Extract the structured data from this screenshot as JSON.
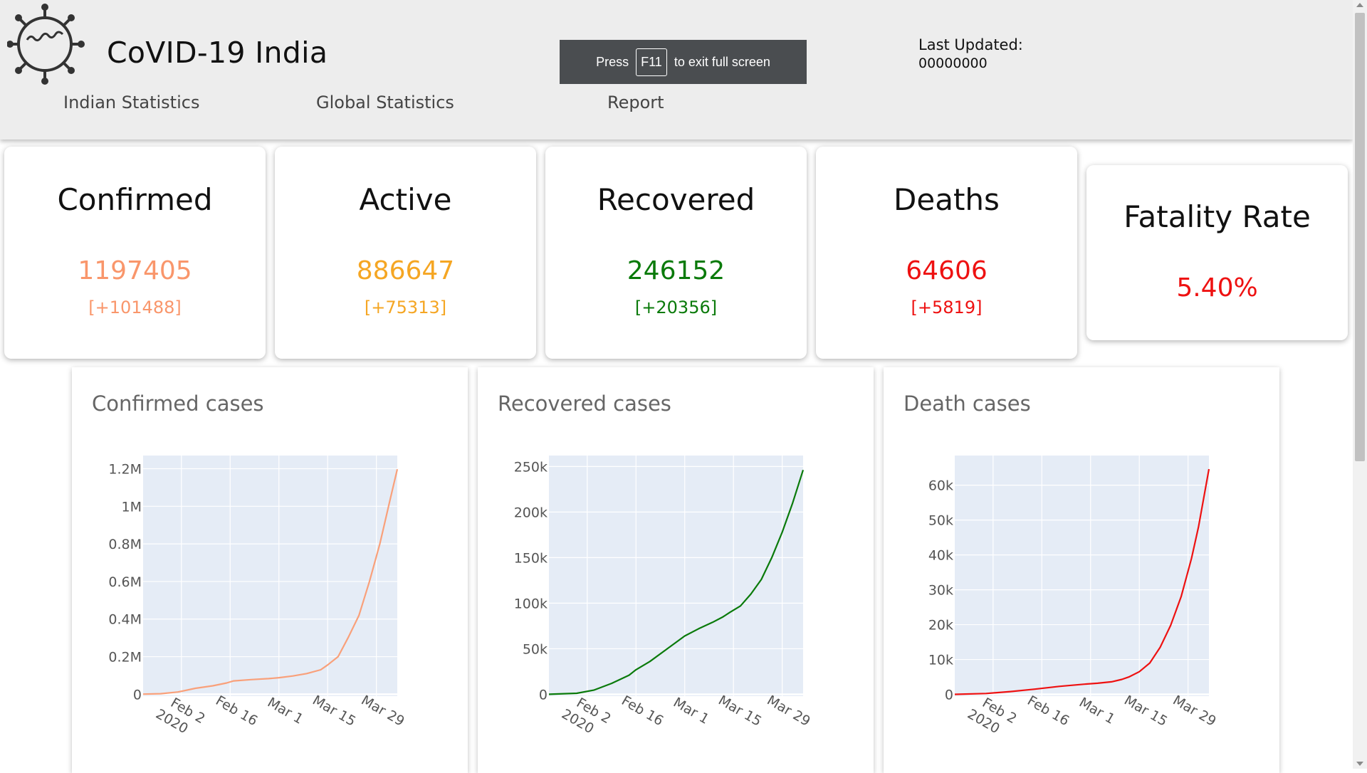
{
  "header": {
    "title": "CoVID-19 India",
    "nav": [
      "Indian Statistics",
      "Global Statistics",
      "Report"
    ],
    "last_updated_label": "Last Updated:",
    "last_updated_value": "00000000"
  },
  "fullscreen_banner": {
    "press": "Press",
    "key": "F11",
    "suffix": "to exit full screen"
  },
  "stats": [
    {
      "title": "Confirmed",
      "value": "1197405",
      "delta": "[+101488]",
      "color": "#f9966b"
    },
    {
      "title": "Active",
      "value": "886647",
      "delta": "[+75313]",
      "color": "#f5a623"
    },
    {
      "title": "Recovered",
      "value": "246152",
      "delta": "[+20356]",
      "color": "#0a7a0a"
    },
    {
      "title": "Deaths",
      "value": "64606",
      "delta": "[+5819]",
      "color": "#ee1111"
    },
    {
      "title": "Fatality Rate",
      "value": "5.40%",
      "color": "#ee1111"
    }
  ],
  "chart_data": [
    {
      "type": "line",
      "title": "Confirmed cases",
      "color": "#f9a07a",
      "x_ticks": [
        "Feb 2\n2020",
        "Feb 16",
        "Mar 1",
        "Mar 15",
        "Mar 29"
      ],
      "x_range": [
        "2020-01-22",
        "2020-04-04"
      ],
      "y_ticks": [
        0,
        200000,
        400000,
        600000,
        800000,
        1000000,
        1200000
      ],
      "y_tick_labels": [
        "0",
        "0.2M",
        "0.4M",
        "0.6M",
        "0.8M",
        "1M",
        "1.2M"
      ],
      "ylim": [
        -10000,
        1270000
      ],
      "x": [
        "2020-01-22",
        "2020-01-27",
        "2020-02-01",
        "2020-02-06",
        "2020-02-11",
        "2020-02-15",
        "2020-02-17",
        "2020-02-22",
        "2020-02-27",
        "2020-03-01",
        "2020-03-05",
        "2020-03-09",
        "2020-03-13",
        "2020-03-15",
        "2020-03-18",
        "2020-03-21",
        "2020-03-24",
        "2020-03-27",
        "2020-03-30",
        "2020-04-02",
        "2020-04-04"
      ],
      "y": [
        555,
        2900,
        12000,
        31500,
        45000,
        60000,
        71000,
        78000,
        83000,
        88000,
        97000,
        110000,
        130000,
        156000,
        200000,
        305000,
        420000,
        600000,
        800000,
        1040000,
        1197405
      ]
    },
    {
      "type": "line",
      "title": "Recovered cases",
      "color": "#0a7a0a",
      "x_ticks": [
        "Feb 2\n2020",
        "Feb 16",
        "Mar 1",
        "Mar 15",
        "Mar 29"
      ],
      "x_range": [
        "2020-01-22",
        "2020-04-04"
      ],
      "y_ticks": [
        0,
        50000,
        100000,
        150000,
        200000,
        250000
      ],
      "y_tick_labels": [
        "0",
        "50k",
        "100k",
        "150k",
        "200k",
        "250k"
      ],
      "ylim": [
        -2000,
        262000
      ],
      "x": [
        "2020-01-22",
        "2020-01-30",
        "2020-02-04",
        "2020-02-09",
        "2020-02-14",
        "2020-02-16",
        "2020-02-20",
        "2020-02-25",
        "2020-03-01",
        "2020-03-05",
        "2020-03-09",
        "2020-03-12",
        "2020-03-14",
        "2020-03-17",
        "2020-03-20",
        "2020-03-23",
        "2020-03-26",
        "2020-03-29",
        "2020-04-01",
        "2020-04-04"
      ],
      "y": [
        28,
        1100,
        4700,
        12000,
        21000,
        27000,
        36000,
        50000,
        64000,
        72000,
        79000,
        85000,
        90000,
        97000,
        110000,
        126000,
        150000,
        178000,
        210000,
        246152
      ]
    },
    {
      "type": "line",
      "title": "Death cases",
      "color": "#ee1111",
      "x_ticks": [
        "Feb 2\n2020",
        "Feb 16",
        "Mar 1",
        "Mar 15",
        "Mar 29"
      ],
      "x_range": [
        "2020-01-22",
        "2020-04-04"
      ],
      "y_ticks": [
        0,
        10000,
        20000,
        30000,
        40000,
        50000,
        60000
      ],
      "y_tick_labels": [
        "0",
        "10k",
        "20k",
        "30k",
        "40k",
        "50k",
        "60k"
      ],
      "ylim": [
        -500,
        68500
      ],
      "x": [
        "2020-01-22",
        "2020-01-31",
        "2020-02-07",
        "2020-02-14",
        "2020-02-21",
        "2020-02-28",
        "2020-03-03",
        "2020-03-07",
        "2020-03-10",
        "2020-03-12",
        "2020-03-15",
        "2020-03-18",
        "2020-03-21",
        "2020-03-24",
        "2020-03-27",
        "2020-03-30",
        "2020-04-01",
        "2020-04-04"
      ],
      "y": [
        17,
        260,
        800,
        1500,
        2300,
        2900,
        3200,
        3600,
        4300,
        5000,
        6500,
        9000,
        13500,
        19800,
        28000,
        39000,
        48000,
        64606
      ]
    }
  ]
}
